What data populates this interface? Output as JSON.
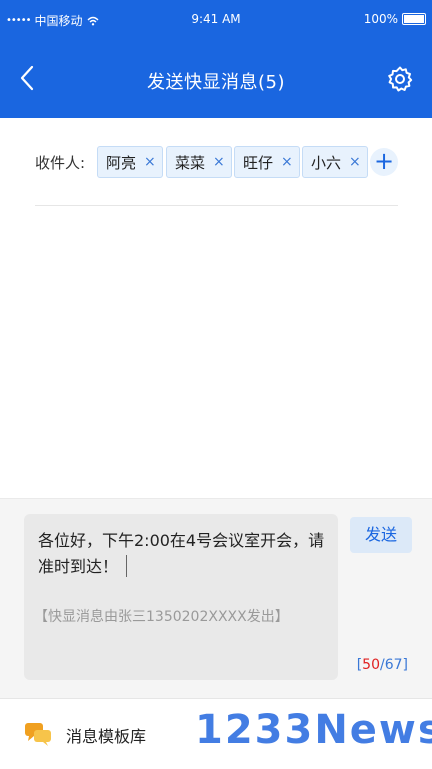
{
  "status_bar": {
    "signal_dots": "•••••",
    "carrier": "中国移动",
    "time": "9:41 AM",
    "battery": "100%"
  },
  "nav": {
    "title": "发送快显消息(5)",
    "back_icon": "chevron-left-icon",
    "settings_icon": "gear-icon"
  },
  "recipients": {
    "label": "收件人:",
    "chips": [
      {
        "name": "阿亮",
        "remove": "×"
      },
      {
        "name": "菜菜",
        "remove": "×"
      },
      {
        "name": "旺仔",
        "remove": "×"
      },
      {
        "name": "小六",
        "remove": "×"
      }
    ],
    "add": "+"
  },
  "compose": {
    "message": "各位好，下午2:00在4号会议室开会，请准时到达！",
    "signature": "【快显消息由张三1350202XXXX发出】",
    "send_label": "发送",
    "counter_current": "50",
    "counter_sep": "/",
    "counter_max": "67",
    "counter_open": "[",
    "counter_close": "]"
  },
  "bottom": {
    "template_label": "消息模板库",
    "template_icon": "chat-bubbles-icon",
    "watermark": "1233News"
  },
  "colors": {
    "primary": "#1a66e0",
    "chip_bg": "#e8f2fd",
    "counter_current": "#e02020"
  }
}
